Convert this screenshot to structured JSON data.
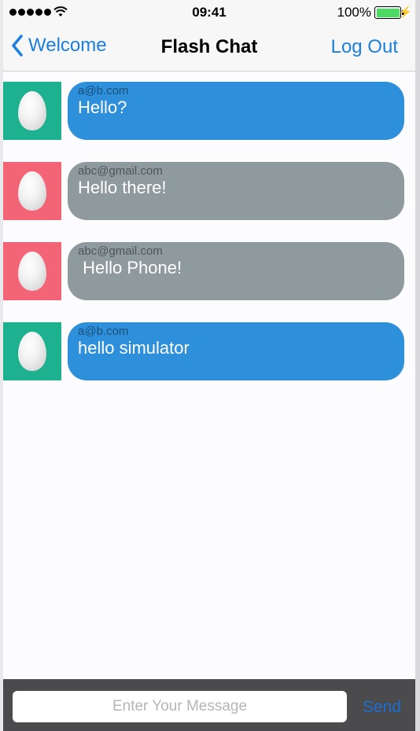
{
  "status_bar": {
    "time": "09:41",
    "battery_percent": "100%",
    "battery_level": 1.0,
    "signal_bars": 5
  },
  "nav": {
    "back_label": "Welcome",
    "title": "Flash Chat",
    "logout_label": "Log Out"
  },
  "messages": [
    {
      "sender": "a@b.com",
      "text": "Hello?",
      "bubble_color": "#2e8fda",
      "avatar_color": "#1eb18f"
    },
    {
      "sender": "abc@gmail.com",
      "text": "Hello there!",
      "bubble_color": "#8f9a9e",
      "avatar_color": "#f26476"
    },
    {
      "sender": "abc@gmail.com",
      "text": " Hello Phone!",
      "bubble_color": "#8f9a9e",
      "avatar_color": "#f26476"
    },
    {
      "sender": "a@b.com",
      "text": "hello simulator",
      "bubble_color": "#2e8fda",
      "avatar_color": "#1eb18f"
    }
  ],
  "compose": {
    "placeholder": "Enter Your Message",
    "send_label": "Send"
  },
  "colors": {
    "accent": "#1a7fde",
    "compose_bar": "#4b4a4c"
  }
}
